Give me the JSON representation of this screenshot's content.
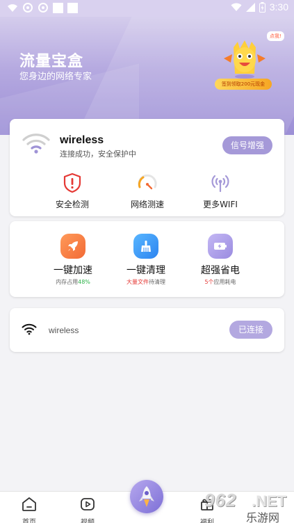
{
  "status_bar": {
    "time": "3:30"
  },
  "header": {
    "title": "流量宝盒",
    "subtitle": "您身边的网络专家",
    "mascot_bubble": "点我!",
    "promo": "签到领取200元现金"
  },
  "connection": {
    "network_name": "wireless",
    "status_text": "连接成功，安全保护中",
    "boost_label": "信号增强",
    "tools": [
      {
        "label": "安全检测",
        "icon": "shield-alert-icon"
      },
      {
        "label": "网络测速",
        "icon": "speedometer-icon"
      },
      {
        "label": "更多WIFI",
        "icon": "wifi-broadcast-icon"
      }
    ]
  },
  "features": [
    {
      "label": "一键加速",
      "sub_prefix": "内存占用",
      "sub_highlight": "48%",
      "sub_suffix": "",
      "icon": "rocket-icon"
    },
    {
      "label": "一键清理",
      "sub_prefix": "",
      "sub_highlight": "大量文件",
      "sub_suffix": "待清理",
      "icon": "broom-icon"
    },
    {
      "label": "超强省电",
      "sub_prefix": "",
      "sub_highlight": "5个",
      "sub_suffix": "应用耗电",
      "icon": "battery-icon"
    }
  ],
  "wifi_list": [
    {
      "name": "wireless",
      "action": "已连接"
    }
  ],
  "bottom_nav": [
    {
      "label": "首页",
      "icon": "home-icon"
    },
    {
      "label": "视频",
      "icon": "video-icon"
    },
    {
      "label": "",
      "icon": "rocket-icon"
    },
    {
      "label": "福利",
      "icon": "gift-icon"
    }
  ],
  "watermark": {
    "number": "962",
    "suffix": ".NET",
    "text": "乐游网"
  },
  "colors": {
    "accent": "#a599d8",
    "header_gradient_top": "#d4ccec",
    "header_gradient_bottom": "#9c8fd6",
    "speed_orange": "#f26a35",
    "clean_blue": "#2d84f0",
    "highlight_green": "#2fb34a",
    "highlight_red": "#e53935"
  }
}
